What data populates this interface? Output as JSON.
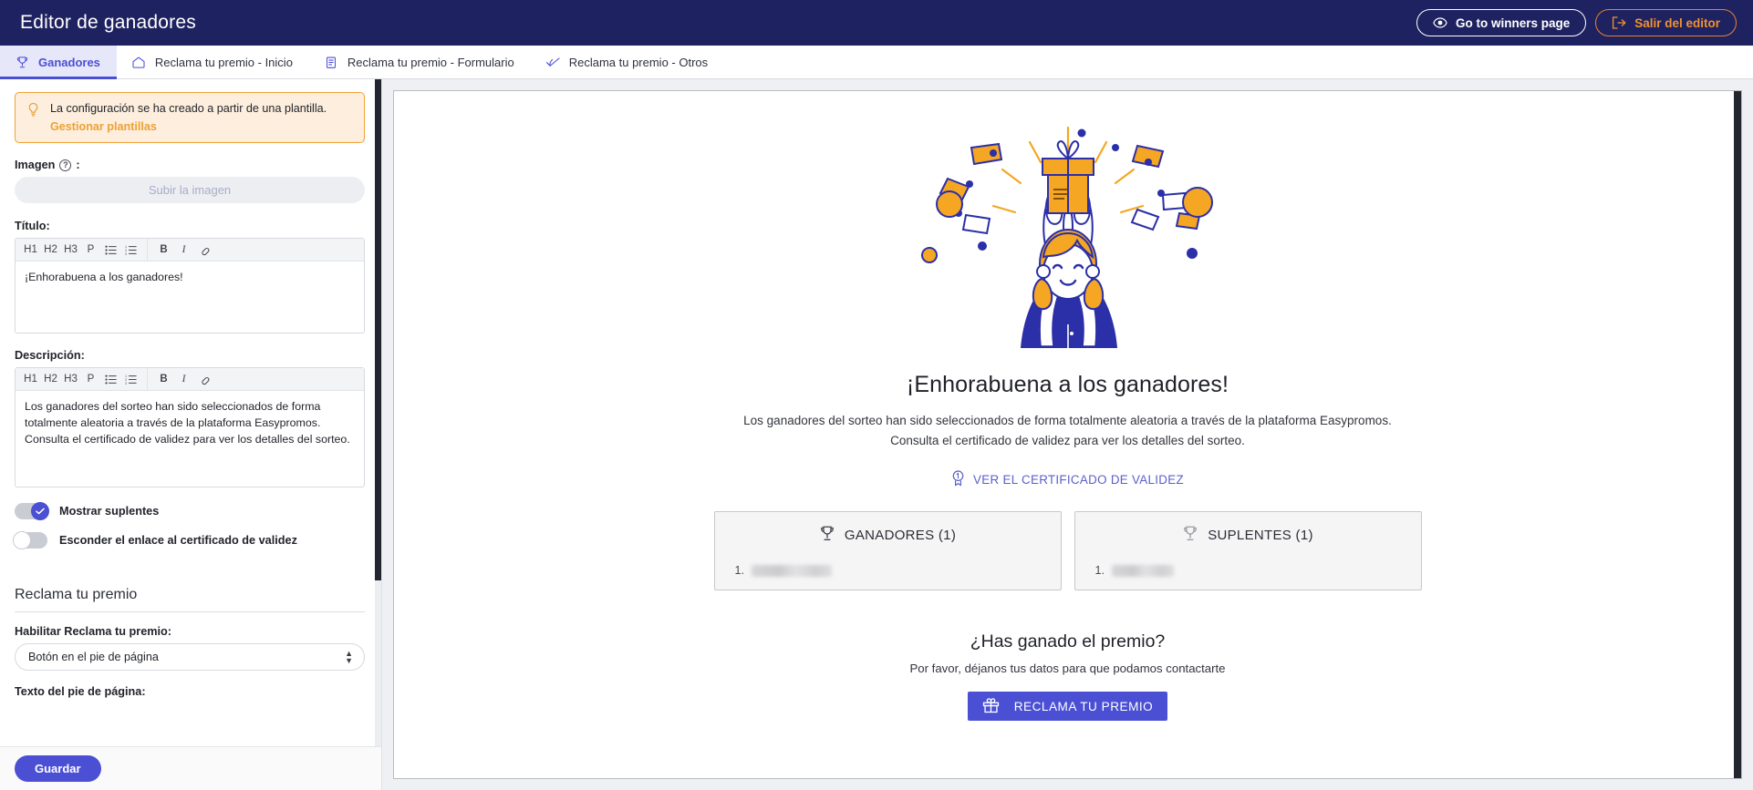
{
  "topbar": {
    "title": "Editor de ganadores",
    "winners_page_button": "Go to winners page",
    "exit_button": "Salir del editor"
  },
  "tabs": [
    {
      "label": "Ganadores",
      "icon": "trophy-icon",
      "active": true
    },
    {
      "label": "Reclama tu premio - Inicio",
      "icon": "home-icon",
      "active": false
    },
    {
      "label": "Reclama tu premio - Formulario",
      "icon": "clipboard-icon",
      "active": false
    },
    {
      "label": "Reclama tu premio - Otros",
      "icon": "check-badge-icon",
      "active": false
    }
  ],
  "sidebar": {
    "alert": {
      "icon": "lightbulb-icon",
      "message": "La configuración se ha creado a partir de una plantilla.",
      "link": "Gestionar plantillas"
    },
    "image_field": {
      "label": "Imagen",
      "help_icon": "question-mark-icon",
      "colon": ":",
      "upload_button": "Subir la imagen"
    },
    "title_field": {
      "label": "Título:",
      "value": "¡Enhorabuena a los ganadores!"
    },
    "description_field": {
      "label": "Descripción:",
      "value": "Los ganadores del sorteo han sido seleccionados de forma totalmente aleatoria a través de la plataforma Easypromos. Consulta el certificado de validez para ver los detalles del sorteo."
    },
    "rte_toolbar": [
      "H1",
      "H2",
      "H3",
      "P",
      "bulleted-list-icon",
      "numbered-list-icon",
      "B",
      "I",
      "link-icon"
    ],
    "toggles": [
      {
        "label": "Mostrar suplentes",
        "on": true
      },
      {
        "label": "Esconder el enlace al certificado de validez",
        "on": false
      }
    ],
    "claim_section": {
      "heading": "Reclama tu premio",
      "enable_label": "Habilitar Reclama tu premio:",
      "enable_value": "Botón en el pie de página",
      "enable_options": [
        "Botón en el pie de página"
      ],
      "footer_text_label": "Texto del pie de página:"
    },
    "save_button": "Guardar"
  },
  "preview": {
    "hero_illustration": "gift-celebration-illustration",
    "title": "¡Enhorabuena a los ganadores!",
    "description": "Los ganadores del sorteo han sido seleccionados de forma totalmente aleatoria a través de la plataforma Easypromos. Consulta el certificado de validez para ver los detalles del sorteo.",
    "certificate_link": "VER EL CERTIFICADO DE VALIDEZ",
    "certificate_icon": "award-seal-icon",
    "lists": [
      {
        "heading": "GANADORES (1)",
        "icon": "trophy-icon",
        "rows": [
          {
            "number": "1.",
            "name": ""
          }
        ]
      },
      {
        "heading": "SUPLENTES (1)",
        "icon": "trophy-icon",
        "rows": [
          {
            "number": "1.",
            "name": ""
          }
        ]
      }
    ],
    "cta": {
      "title": "¿Has ganado el premio?",
      "subtitle": "Por favor, déjanos tus datos para que podamos contactarte",
      "button": "RECLAMA TU PREMIO",
      "button_icon": "gift-icon"
    }
  },
  "colors": {
    "header_navy": "#1f2260",
    "accent_indigo": "#4a4fd4",
    "accent_orange": "#f0922f",
    "alert_border": "#f0a233",
    "alert_bg": "#fdeedd",
    "preview_bg": "#eef0f3"
  }
}
